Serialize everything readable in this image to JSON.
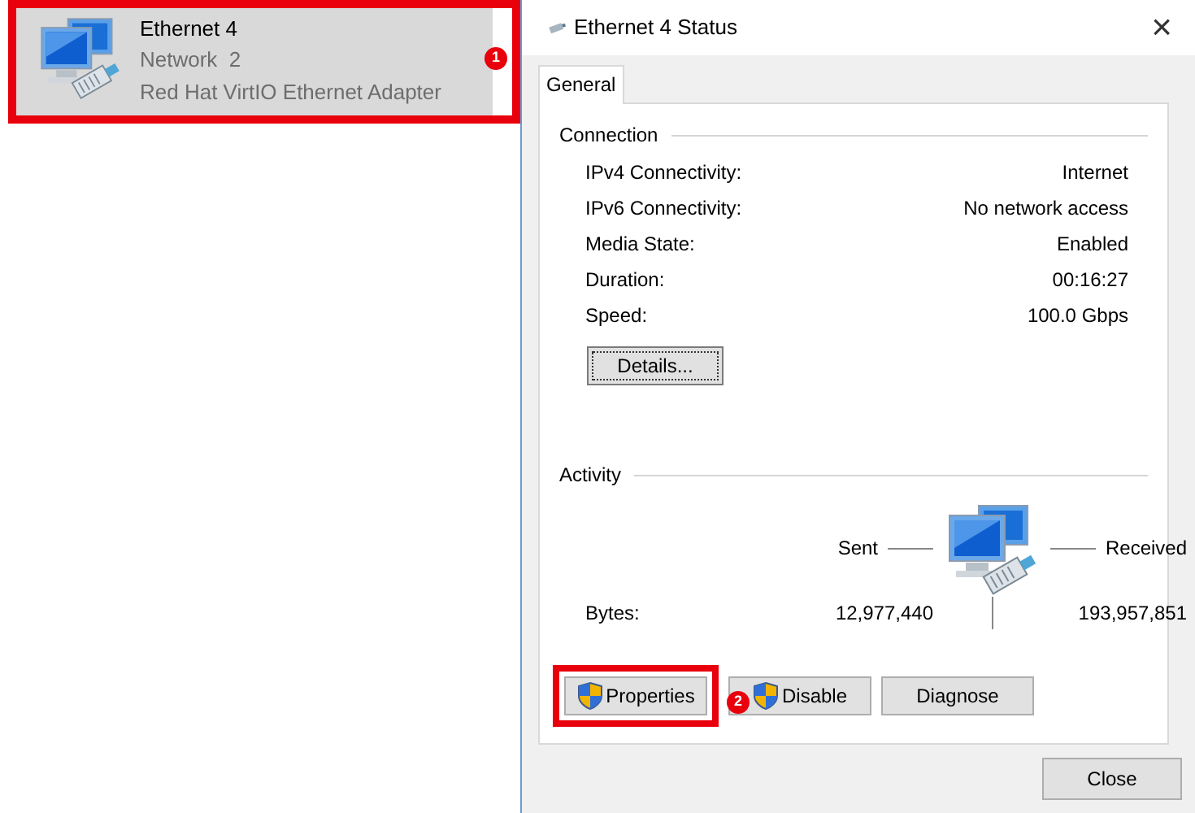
{
  "adapter": {
    "name": "Ethernet 4",
    "network": "Network  2",
    "device": "Red Hat VirtIO Ethernet Adapter",
    "selected": true,
    "callout": "1"
  },
  "dialog": {
    "title": "Ethernet 4 Status",
    "close_glyph": "×",
    "tabs": [
      {
        "label": "General",
        "selected": true
      }
    ],
    "connection": {
      "heading": "Connection",
      "rows": [
        {
          "label": "IPv4 Connectivity:",
          "value": "Internet"
        },
        {
          "label": "IPv6 Connectivity:",
          "value": "No network access"
        },
        {
          "label": "Media State:",
          "value": "Enabled"
        },
        {
          "label": "Duration:",
          "value": "00:16:27"
        },
        {
          "label": "Speed:",
          "value": "100.0 Gbps"
        }
      ],
      "details_button": "Details..."
    },
    "activity": {
      "heading": "Activity",
      "sent_label": "Sent",
      "received_label": "Received",
      "bytes_label": "Bytes:",
      "sent_bytes": "12,977,440",
      "received_bytes": "193,957,851"
    },
    "buttons": [
      {
        "label": "Properties",
        "shield": true,
        "callout": "2"
      },
      {
        "label": "Disable",
        "shield": true
      },
      {
        "label": "Diagnose",
        "shield": false
      }
    ],
    "close_button": "Close"
  }
}
